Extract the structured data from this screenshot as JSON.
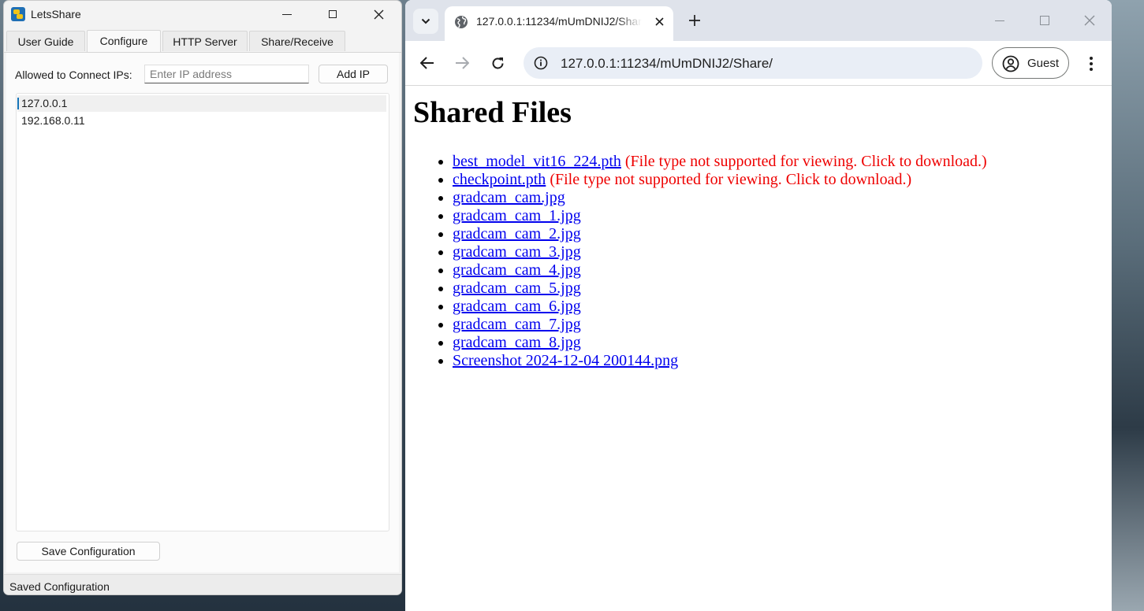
{
  "app": {
    "title": "LetsShare",
    "tabs": [
      "User Guide",
      "Configure",
      "HTTP Server",
      "Share/Receive"
    ],
    "active_tab": "Configure",
    "config": {
      "ip_label": "Allowed to Connect IPs:",
      "ip_placeholder": "Enter IP address",
      "add_button": "Add IP",
      "ips": [
        "127.0.0.1",
        "192.168.0.11"
      ],
      "selected_ip": "127.0.0.1",
      "save_button": "Save Configuration"
    },
    "status": "Saved Configuration"
  },
  "browser": {
    "tab_title": "127.0.0.1:11234/mUmDNIJ2/Share/",
    "url": "127.0.0.1:11234/mUmDNIJ2/Share/",
    "profile_label": "Guest",
    "page": {
      "heading": "Shared Files",
      "files": [
        {
          "name": "best_model_vit16_224.pth",
          "note": "(File type not supported for viewing. Click to download.)"
        },
        {
          "name": "checkpoint.pth",
          "note": "(File type not supported for viewing. Click to download.)"
        },
        {
          "name": "gradcam_cam.jpg",
          "note": ""
        },
        {
          "name": "gradcam_cam_1.jpg",
          "note": ""
        },
        {
          "name": "gradcam_cam_2.jpg",
          "note": ""
        },
        {
          "name": "gradcam_cam_3.jpg",
          "note": ""
        },
        {
          "name": "gradcam_cam_4.jpg",
          "note": ""
        },
        {
          "name": "gradcam_cam_5.jpg",
          "note": ""
        },
        {
          "name": "gradcam_cam_6.jpg",
          "note": ""
        },
        {
          "name": "gradcam_cam_7.jpg",
          "note": ""
        },
        {
          "name": "gradcam_cam_8.jpg",
          "note": ""
        },
        {
          "name": "Screenshot 2024-12-04 200144.png",
          "note": ""
        }
      ]
    }
  },
  "colors": {
    "link": "#0000ee",
    "note": "#ee0000",
    "accent": "#1573b7"
  }
}
